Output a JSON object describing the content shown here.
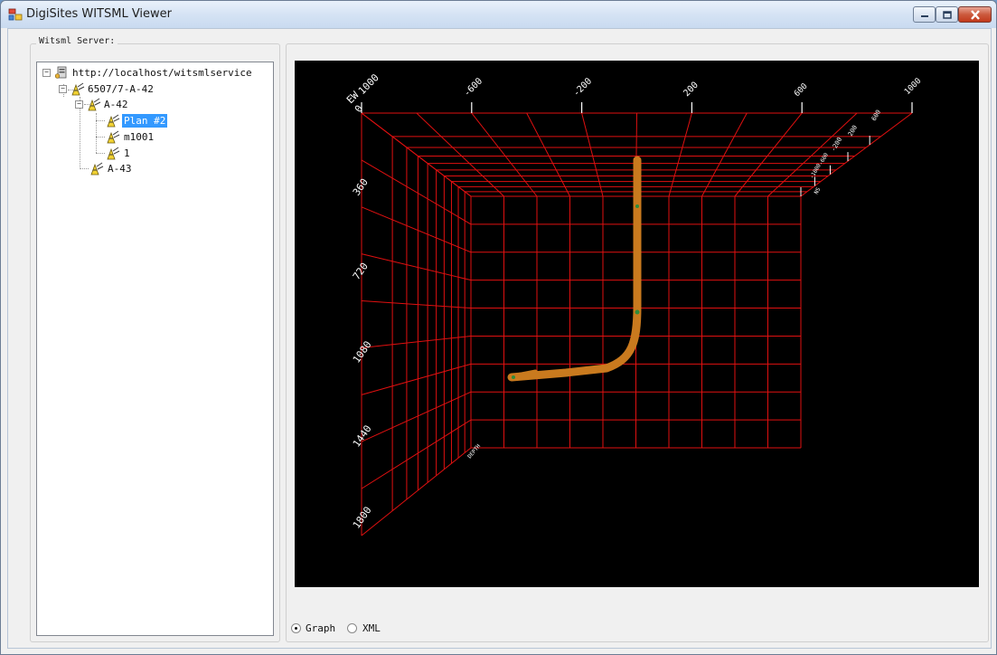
{
  "window": {
    "title": "DigiSites WITSML Viewer",
    "controls": {
      "minimize": "minimize",
      "maximize": "maximize",
      "close": "close"
    }
  },
  "group": {
    "label": "Witsml Server:"
  },
  "tree": {
    "root": "http://localhost/witsmlservice",
    "well": "6507/7-A-42",
    "wellbore_a42": "A-42",
    "traj_plan2": "Plan #2",
    "traj_m1001": "m1001",
    "traj_1": "1",
    "wellbore_a43": "A-43",
    "selected": "Plan #2"
  },
  "view_mode": {
    "options": [
      "Graph",
      "XML"
    ],
    "selected": "Graph"
  },
  "plot": {
    "ew_axis_title": "EW",
    "ew_ticks": [
      "1000",
      "-600",
      "-200",
      "200",
      "600",
      "1000"
    ],
    "depth_ticks": [
      "0",
      "360",
      "720",
      "1080",
      "1440",
      "1800"
    ],
    "ns_ticks": [
      "600",
      "200",
      "-200",
      "-600",
      "-1000"
    ],
    "ns_axis_title": "NS",
    "depth_axis_title": "DEPTH",
    "grid_color": "#e01010",
    "trajectory_color": "#c97a1e",
    "marker_color": "#2e8b3a"
  }
}
